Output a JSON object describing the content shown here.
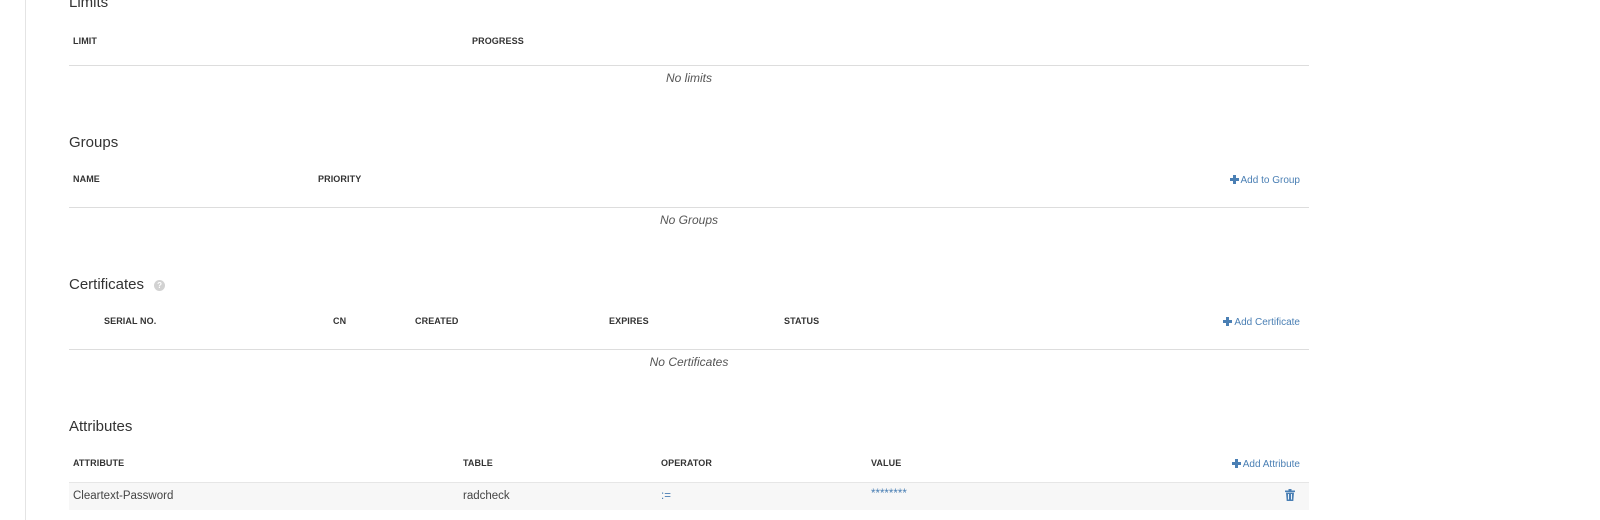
{
  "limits": {
    "title": "Limits",
    "columns": [
      "LIMIT",
      "PROGRESS"
    ],
    "empty_text": "No limits"
  },
  "groups": {
    "title": "Groups",
    "columns": [
      "NAME",
      "PRIORITY"
    ],
    "add_label": "Add to Group",
    "empty_text": "No Groups"
  },
  "certificates": {
    "title": "Certificates",
    "help_icon": "question-circle-icon",
    "columns": [
      "SERIAL NO.",
      "CN",
      "CREATED",
      "EXPIRES",
      "STATUS"
    ],
    "add_label": "Add Certificate",
    "empty_text": "No Certificates"
  },
  "attributes": {
    "title": "Attributes",
    "columns": [
      "ATTRIBUTE",
      "TABLE",
      "OPERATOR",
      "VALUE"
    ],
    "add_label": "Add Attribute",
    "rows": [
      {
        "attribute": "Cleartext-Password",
        "table": "radcheck",
        "operator": ":=",
        "value": "********"
      }
    ]
  },
  "colors": {
    "link": "#4a7fb4",
    "header_line": "#dddddd",
    "row_bg": "#f7f7f7"
  },
  "icons": {
    "add": "plus-icon",
    "delete": "trash-icon"
  }
}
